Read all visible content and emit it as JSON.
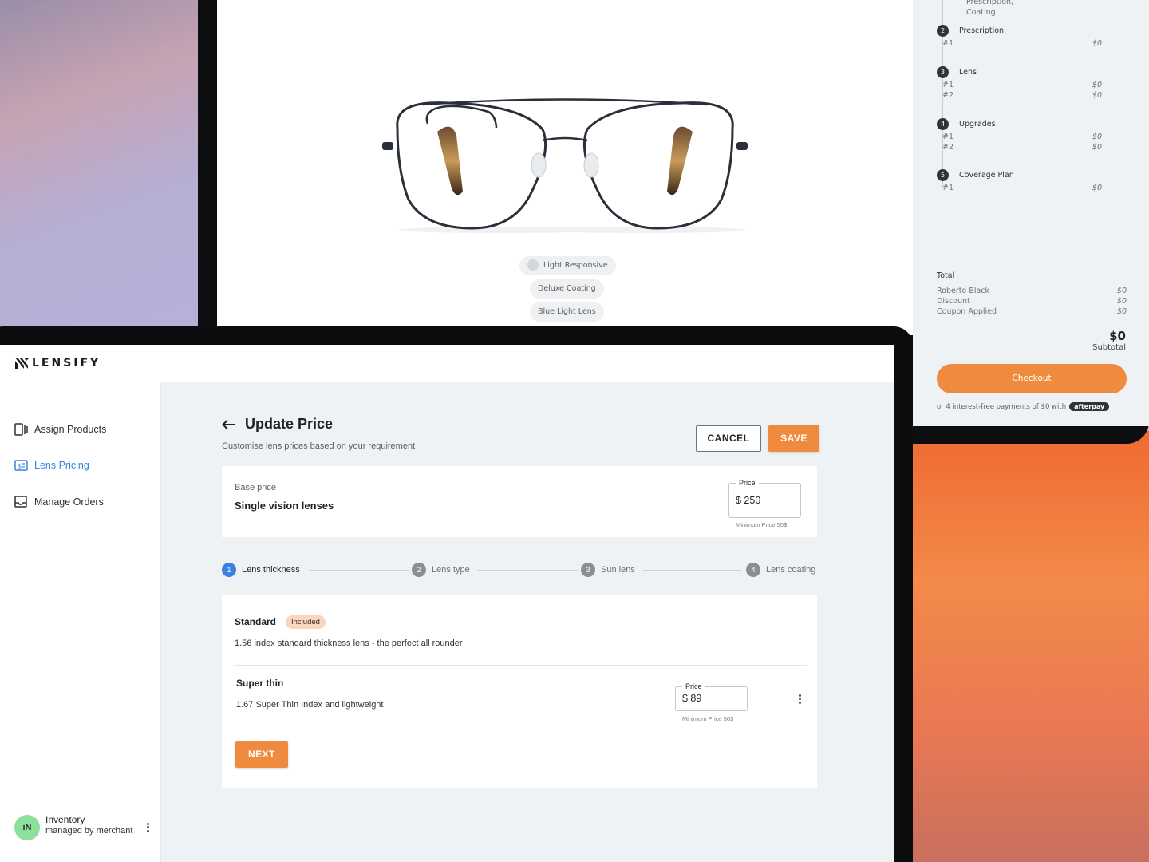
{
  "product_preview": {
    "chips": [
      "Light Responsive",
      "Deluxe Coating",
      "Blue Light Lens"
    ]
  },
  "order_summary": {
    "top_note": [
      "Prescription,",
      "Coating"
    ],
    "steps": [
      {
        "num": "2",
        "name": "Prescription",
        "rows": [
          {
            "label": "#1",
            "value": "$0"
          }
        ]
      },
      {
        "num": "3",
        "name": "Lens",
        "rows": [
          {
            "label": "#1",
            "value": "$0"
          },
          {
            "label": "#2",
            "value": "$0"
          }
        ]
      },
      {
        "num": "4",
        "name": "Upgrades",
        "rows": [
          {
            "label": "#1",
            "value": "$0"
          },
          {
            "label": "#2",
            "value": "$0"
          }
        ]
      },
      {
        "num": "5",
        "name": "Coverage Plan",
        "rows": [
          {
            "label": "#1",
            "value": "$0"
          }
        ]
      }
    ],
    "total_label": "Total",
    "total_rows": [
      {
        "label": "Roberto Black",
        "value": "$0"
      },
      {
        "label": "Discount",
        "value": "$0"
      },
      {
        "label": "Coupon Applied",
        "value": "$0"
      }
    ],
    "grand_total": "$0",
    "subtotal_label": "Subtotal",
    "checkout_label": "Checkout",
    "afterpay_text": "or 4 interest-free payments of $0 with",
    "afterpay_badge": "afterpay"
  },
  "app": {
    "brand": "LENSIFY",
    "nav": [
      {
        "label": "Assign Products",
        "icon": "assign-products-icon",
        "active": false
      },
      {
        "label": "Lens Pricing",
        "icon": "lens-pricing-icon",
        "active": true
      },
      {
        "label": "Manage Orders",
        "icon": "manage-orders-icon",
        "active": false
      }
    ],
    "user": {
      "initials": "iN",
      "name": "Inventory",
      "subtitle": "managed by merchant"
    },
    "accent": "#f08a3e",
    "active_color": "#3b82e0"
  },
  "page": {
    "title": "Update Price",
    "subtitle": "Customise lens prices based on your requirement",
    "cancel_label": "CANCEL",
    "save_label": "SAVE",
    "base": {
      "label": "Base price",
      "title": "Single vision lenses",
      "price_label": "Price",
      "price_value": "$ 250",
      "min_note": "Minimum Price 50$"
    },
    "steps": [
      {
        "num": "1",
        "label": "Lens thickness",
        "active": true
      },
      {
        "num": "2",
        "label": "Lens type",
        "active": false
      },
      {
        "num": "3",
        "label": "Sun lens",
        "active": false
      },
      {
        "num": "4",
        "label": "Lens coating",
        "active": false
      }
    ],
    "options": [
      {
        "title": "Standard",
        "badge": "Included",
        "description": "1.56 index standard thickness lens - the perfect all rounder"
      },
      {
        "title": "Super thin",
        "description": "1.67 Super Thin Index and lightweight",
        "price_label": "Price",
        "price_value": "$ 89",
        "min_note": "Minimum Price 50$"
      }
    ],
    "next_label": "NEXT"
  }
}
